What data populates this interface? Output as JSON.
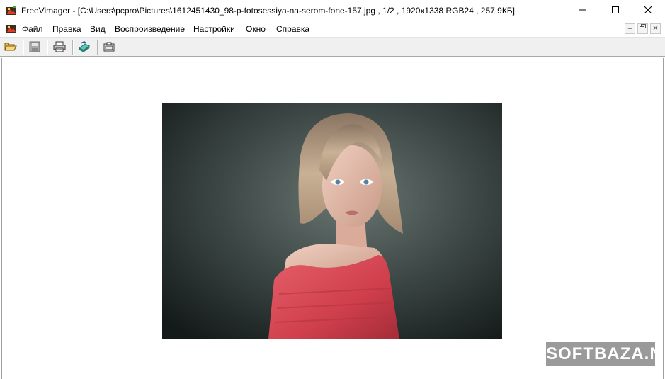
{
  "window": {
    "title": "FreeVimager - [C:\\Users\\pcpro\\Pictures\\1612451430_98-p-fotosessiya-na-serom-fone-157.jpg , 1/2 , 1920x1338 RGB24 , 257.9КБ]",
    "buttons": [
      "minimize-icon",
      "maximize-icon",
      "close-icon"
    ]
  },
  "menubar": {
    "items": [
      {
        "label": "Файл"
      },
      {
        "label": "Правка"
      },
      {
        "label": "Вид"
      },
      {
        "label": "Воспроизведение"
      },
      {
        "label": "Настройки"
      },
      {
        "label": "Окно"
      },
      {
        "label": "Справка"
      }
    ],
    "mdi_buttons": [
      "mdi-minimize-icon",
      "mdi-restore-icon",
      "mdi-close-icon"
    ]
  },
  "toolbar": {
    "buttons": [
      "open-folder-icon",
      "save-icon",
      "print-icon",
      "scan-icon",
      "capture-icon"
    ]
  },
  "watermark": {
    "text": "SOFTBAZA.NET"
  },
  "colors": {
    "photo_background": "#2f3a38",
    "dress": "#d94b57",
    "hair": "#b89c80",
    "watermark_bg": "#9a9a9a"
  }
}
